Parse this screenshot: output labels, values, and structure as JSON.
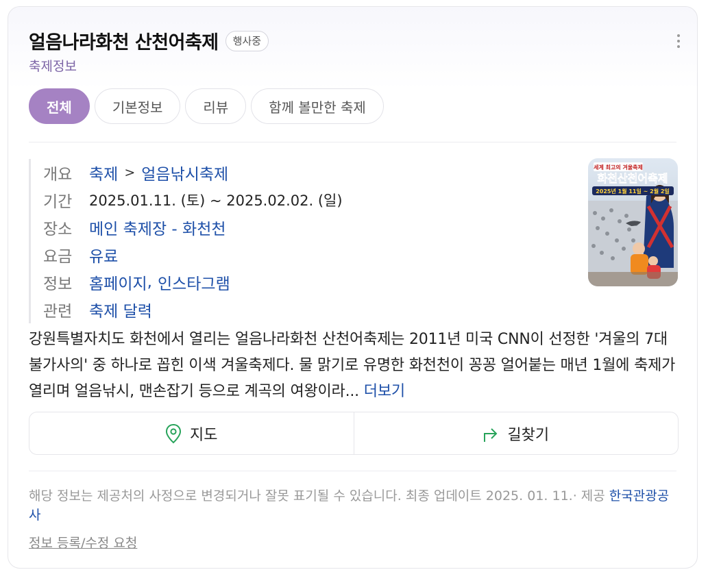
{
  "header": {
    "title": "얼음나라화천 산천어축제",
    "badge": "행사중",
    "subtitle": "축제정보"
  },
  "tabs": [
    {
      "label": "전체",
      "active": true
    },
    {
      "label": "기본정보",
      "active": false
    },
    {
      "label": "리뷰",
      "active": false
    },
    {
      "label": "함께 볼만한 축제",
      "active": false
    }
  ],
  "info": {
    "overview": {
      "label": "개요",
      "category": "축제",
      "separator": ">",
      "subcategory": "얼음낚시축제"
    },
    "period": {
      "label": "기간",
      "value": "2025.01.11. (토) ~  2025.02.02. (일)"
    },
    "place": {
      "label": "장소",
      "value": "메인 축제장 - 화천천"
    },
    "fee": {
      "label": "요금",
      "value": "유료"
    },
    "links": {
      "label": "정보",
      "homepage": "홈페이지",
      "comma": ",",
      "instagram": "인스타그램"
    },
    "related": {
      "label": "관련",
      "value": "축제 달력"
    }
  },
  "poster": {
    "top_text": "세계 최고의 겨울축제",
    "title": "화천산천어축제",
    "dates": "2025년 1월 11일 ~ 2월 2일"
  },
  "description": {
    "text": "강원특별자치도 화천에서 열리는 얼음나라화천 산천어축제는 2011년 미국 CNN이 선정한 '겨울의 7대 불가사의' 중 하나로 꼽힌 이색 겨울축제다. 물 맑기로 유명한 화천천이 꽁꽁 얼어붙는 매년 1월에 축제가 열리며 얼음낚시, 맨손잡기 등으로 계곡의 여왕이라...",
    "more": "더보기"
  },
  "actions": {
    "map": "지도",
    "directions": "길찾기"
  },
  "footer": {
    "notice": "해당 정보는 제공처의 사정으로 변경되거나 잘못 표기될 수 있습니다. 최종 업데이트 2025. 01. 11.· 제공",
    "provider": "한국관광공사",
    "request": "정보 등록/수정 요청"
  },
  "colors": {
    "accent": "#a582c3",
    "link": "#1d4fa8",
    "icon_green": "#27a35a"
  }
}
